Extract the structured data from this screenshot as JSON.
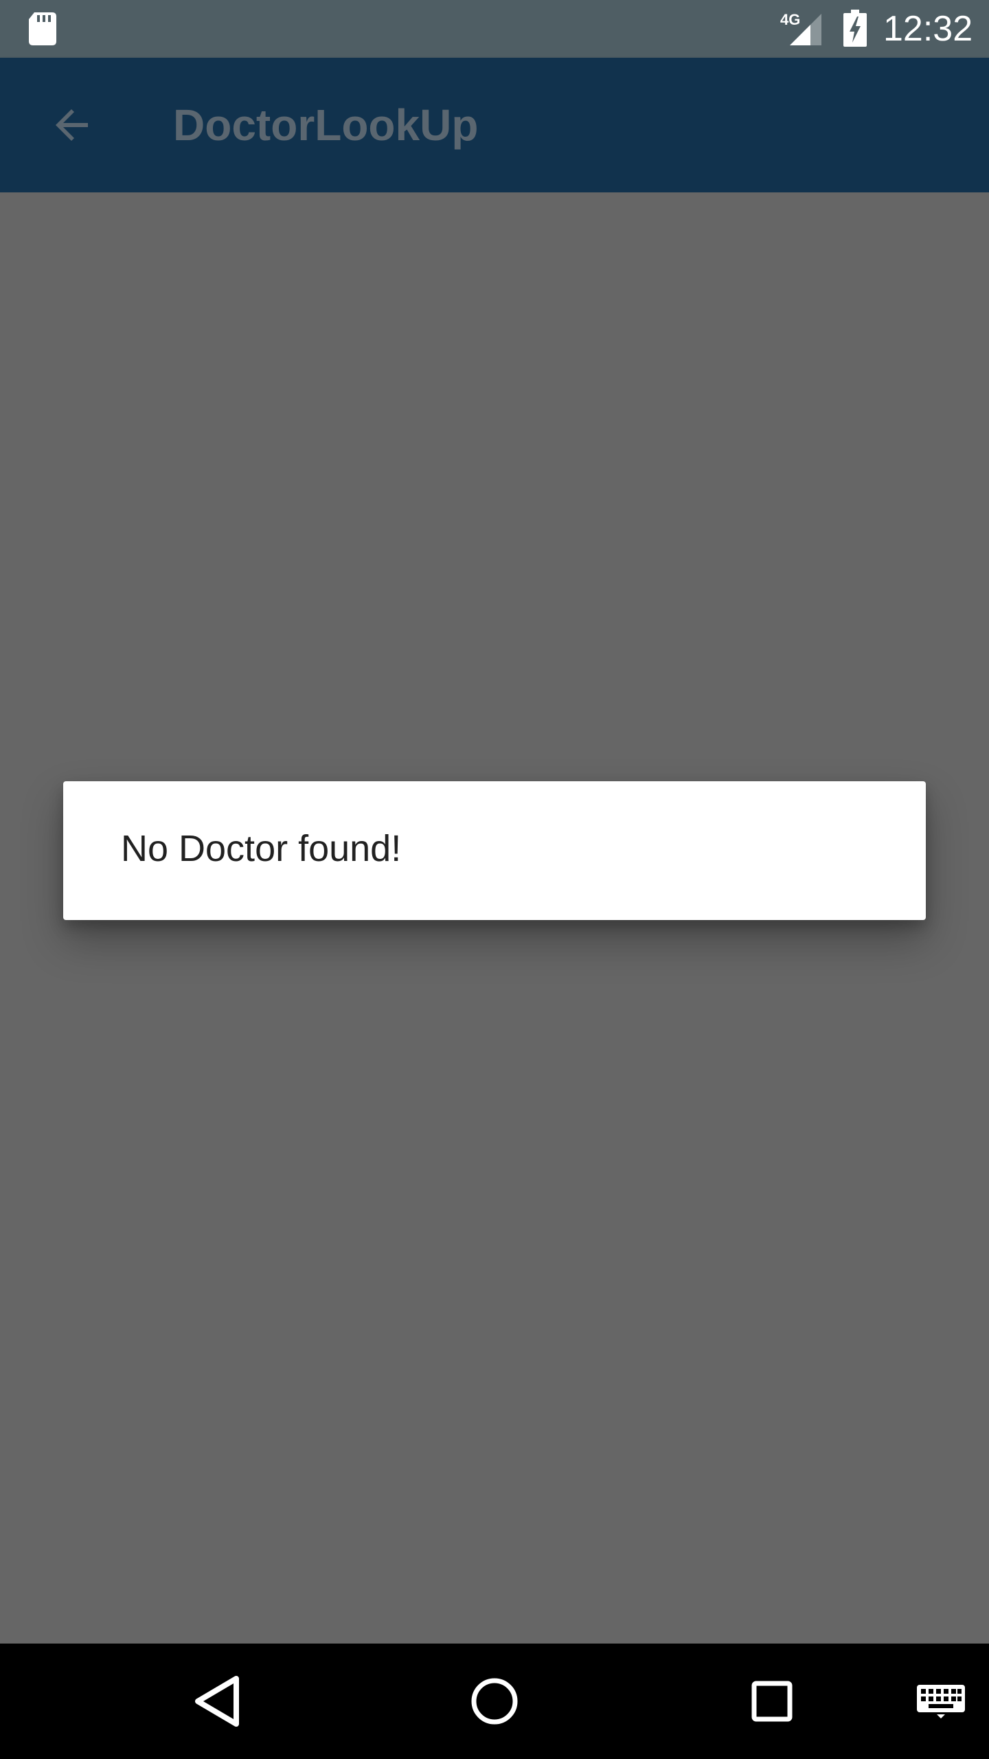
{
  "status_bar": {
    "network_type": "4G",
    "time": "12:32",
    "icons": [
      "sd-card-icon",
      "cell-signal-icon",
      "battery-charging-icon"
    ]
  },
  "app_bar": {
    "title": "DoctorLookUp",
    "back_icon": "arrow-back-icon"
  },
  "dialog": {
    "message": "No Doctor found!"
  },
  "nav_bar": {
    "icons": [
      "nav-back-icon",
      "nav-home-icon",
      "nav-recents-icon",
      "keyboard-icon"
    ]
  },
  "colors": {
    "scrim": "#666666",
    "status_bar": "#4f5e64",
    "app_bar": "#11324d",
    "dialog": "#ffffff",
    "nav_bar": "#000000"
  }
}
